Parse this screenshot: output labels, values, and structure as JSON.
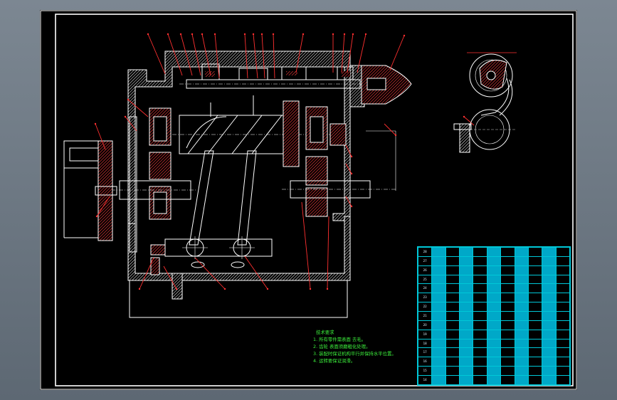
{
  "drawing": {
    "technical_requirements": {
      "title": "技术要求",
      "items": [
        "1. 所有零件需表面 去毛。",
        "2. 齿轮 表面须磨粗化处理。",
        "3. 装配时保证机构平行并保持水平位置。",
        "4. 运转要保证润滑。"
      ]
    },
    "bom_rows": [
      [
        "28",
        "",
        "",
        "",
        "",
        "",
        "",
        "",
        "",
        "",
        ""
      ],
      [
        "27",
        "",
        "",
        "",
        "",
        "",
        "",
        "",
        "",
        "",
        ""
      ],
      [
        "26",
        "",
        "",
        "",
        "",
        "",
        "",
        "",
        "",
        "",
        ""
      ],
      [
        "25",
        "",
        "",
        "",
        "",
        "",
        "",
        "",
        "",
        "",
        ""
      ],
      [
        "24",
        "",
        "",
        "",
        "",
        "",
        "",
        "",
        "",
        "",
        ""
      ],
      [
        "23",
        "",
        "",
        "",
        "",
        "",
        "",
        "",
        "",
        "",
        ""
      ],
      [
        "22",
        "",
        "",
        "",
        "",
        "",
        "",
        "",
        "",
        "",
        ""
      ],
      [
        "21",
        "",
        "",
        "",
        "",
        "",
        "",
        "",
        "",
        "",
        ""
      ],
      [
        "20",
        "",
        "",
        "",
        "",
        "",
        "",
        "",
        "",
        "",
        ""
      ],
      [
        "19",
        "",
        "",
        "",
        "",
        "",
        "",
        "",
        "",
        "",
        ""
      ],
      [
        "18",
        "",
        "",
        "",
        "",
        "",
        "",
        "",
        "",
        "",
        ""
      ],
      [
        "17",
        "",
        "",
        "",
        "",
        "",
        "",
        "",
        "",
        "",
        ""
      ],
      [
        "16",
        "",
        "",
        "",
        "",
        "",
        "",
        "",
        "",
        "",
        ""
      ],
      [
        "15",
        "",
        "",
        "",
        "",
        "",
        "",
        "",
        "",
        "",
        ""
      ],
      [
        "14",
        "",
        "",
        "",
        "",
        "",
        "",
        "",
        "",
        "",
        ""
      ]
    ],
    "colors": {
      "line": "#ffffff",
      "leader": "#ff3030",
      "notes": "#3cf03c",
      "table": "#00c8d8"
    }
  }
}
